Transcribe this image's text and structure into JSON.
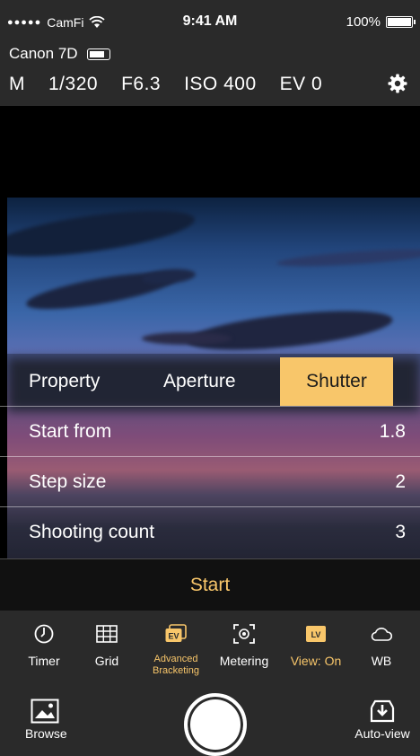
{
  "status": {
    "signal": "●●●●●",
    "carrier": "CamFi",
    "time": "9:41 AM",
    "battery": "100%"
  },
  "camera": {
    "name": "Canon 7D",
    "mode": "M",
    "shutter": "1/320",
    "aperture": "F6.3",
    "iso": "ISO 400",
    "ev": "EV 0"
  },
  "bracketing": {
    "tabs": [
      "Property",
      "Aperture",
      "Shutter"
    ],
    "selected_tab": "Shutter",
    "rows": [
      {
        "label": "Start from",
        "value": "1.8"
      },
      {
        "label": "Step size",
        "value": "2"
      },
      {
        "label": "Shooting count",
        "value": "3"
      }
    ],
    "start_label": "Start"
  },
  "toolbar": {
    "items": [
      {
        "label": "Timer",
        "icon": "timer-icon"
      },
      {
        "label": "Grid",
        "icon": "grid-icon"
      },
      {
        "label": "Advanced",
        "label2": "Bracketing",
        "icon": "ev-bracketing-icon"
      },
      {
        "label": "Metering",
        "icon": "metering-icon"
      },
      {
        "label": "View: On",
        "icon": "live-view-icon"
      },
      {
        "label": "WB",
        "icon": "cloud-icon"
      }
    ],
    "browse_label": "Browse",
    "autoview_label": "Auto-view"
  },
  "colors": {
    "accent": "#f8c66a",
    "panel": "#2a2a2a"
  }
}
